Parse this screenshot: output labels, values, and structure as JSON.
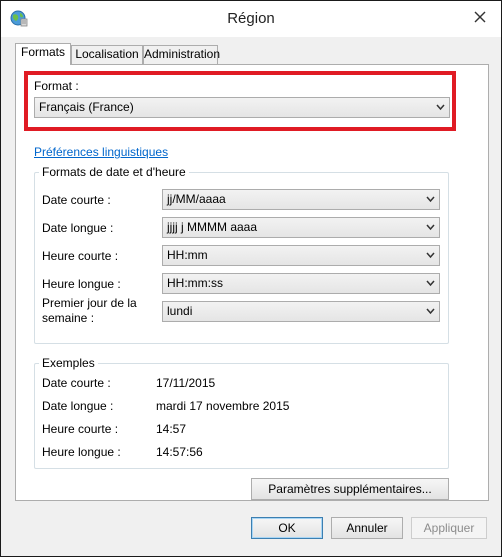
{
  "window": {
    "title": "Région",
    "icon": "region-globe-icon",
    "close_icon": "close-icon"
  },
  "tabs": [
    {
      "label": "Formats",
      "active": true
    },
    {
      "label": "Localisation",
      "active": false
    },
    {
      "label": "Administration",
      "active": false
    }
  ],
  "format": {
    "label": "Format :",
    "value": "Français (France)",
    "highlight_color": "#e01b24"
  },
  "language_prefs_link": "Préférences linguistiques",
  "date_time_formats": {
    "title": "Formats de date et d'heure",
    "fields": [
      {
        "label": "Date courte :",
        "value": "jj/MM/aaaa"
      },
      {
        "label": "Date longue :",
        "value": "jjjj j MMMM aaaa"
      },
      {
        "label": "Heure courte :",
        "value": "HH:mm"
      },
      {
        "label": "Heure longue :",
        "value": "HH:mm:ss"
      },
      {
        "label_line1": "Premier jour de la",
        "label_line2": "semaine :",
        "value": "lundi"
      }
    ]
  },
  "examples": {
    "title": "Exemples",
    "rows": [
      {
        "label": "Date courte :",
        "value": "17/11/2015"
      },
      {
        "label": "Date longue :",
        "value": "mardi 17 novembre 2015"
      },
      {
        "label": "Heure courte :",
        "value": "14:57"
      },
      {
        "label": "Heure longue :",
        "value": "14:57:56"
      }
    ]
  },
  "buttons": {
    "additional_settings": "Paramètres supplémentaires...",
    "ok": "OK",
    "cancel": "Annuler",
    "apply": "Appliquer"
  },
  "colors": {
    "link": "#0066cc",
    "highlight": "#e01b24",
    "default_button_border": "#3c7fb1"
  }
}
